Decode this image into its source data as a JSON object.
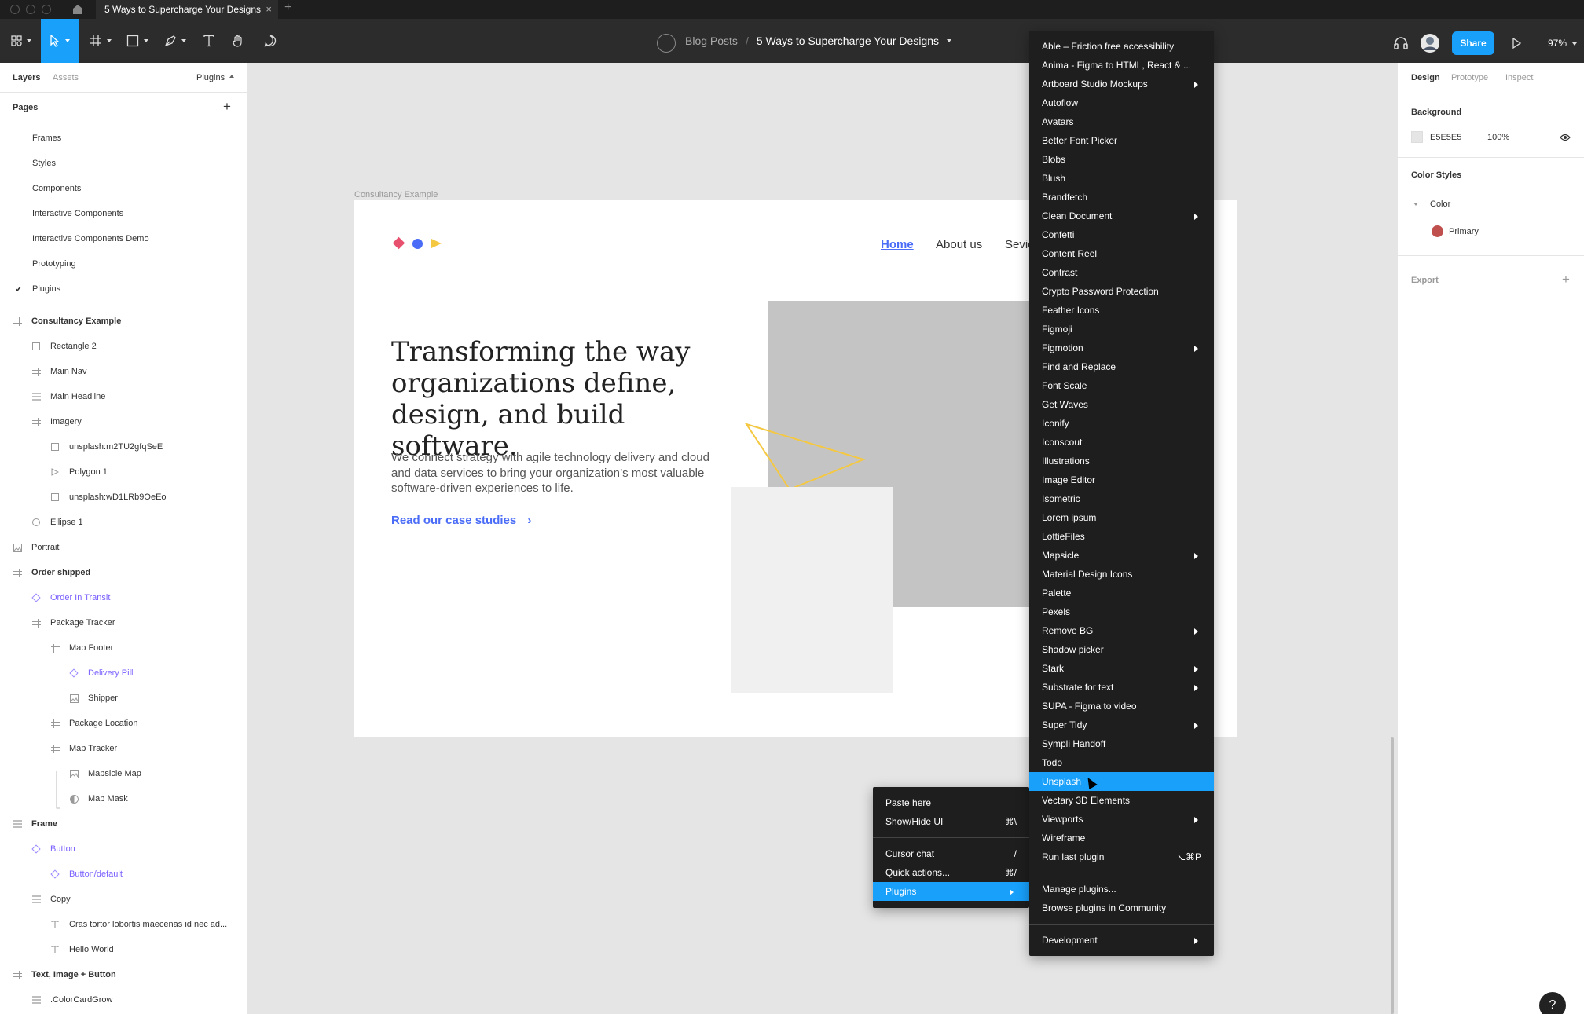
{
  "window": {
    "tab_title": "5 Ways to Supercharge Your Designs",
    "tab_close": "×",
    "new_tab": "+"
  },
  "toolbar": {
    "project": "Blog Posts",
    "separator": "/",
    "file": "5 Ways to Supercharge Your Designs",
    "share": "Share",
    "zoom": "97%"
  },
  "left_panel": {
    "tabs": {
      "layers": "Layers",
      "assets": "Assets",
      "plugins": "Plugins"
    },
    "pages_heading": "Pages",
    "add_page": "+",
    "pages": [
      "Frames",
      "Styles",
      "Components",
      "Interactive Components",
      "Interactive Components Demo",
      "Prototyping",
      "Plugins"
    ],
    "current_page_check": "✔",
    "layers": [
      {
        "name": "Consultancy Example",
        "icon": "frame-icon",
        "bold": true
      },
      {
        "name": "Rectangle 2",
        "icon": "rectangle-icon"
      },
      {
        "name": "Main Nav",
        "icon": "frame-icon"
      },
      {
        "name": "Main Headline",
        "icon": "autolayout-icon"
      },
      {
        "name": "Imagery",
        "icon": "frame-icon"
      },
      {
        "name": "unsplash:m2TU2gfqSeE",
        "icon": "rectangle-icon"
      },
      {
        "name": "Polygon 1",
        "icon": "polygon-icon"
      },
      {
        "name": "unsplash:wD1LRb9OeEo",
        "icon": "rectangle-icon"
      },
      {
        "name": "Ellipse 1",
        "icon": "ellipse-icon"
      },
      {
        "name": "Portrait",
        "icon": "image-icon"
      },
      {
        "name": "Order shipped",
        "icon": "frame-icon",
        "bold": true
      },
      {
        "name": "Order In Transit",
        "icon": "component-instance-icon",
        "purple": true
      },
      {
        "name": "Package Tracker",
        "icon": "frame-icon"
      },
      {
        "name": "Map Footer",
        "icon": "frame-icon"
      },
      {
        "name": "Delivery Pill",
        "icon": "component-instance-icon",
        "purple": true
      },
      {
        "name": "Shipper",
        "icon": "image-icon"
      },
      {
        "name": "Package Location",
        "icon": "frame-icon"
      },
      {
        "name": "Map Tracker",
        "icon": "frame-icon"
      },
      {
        "name": "Mapsicle Map",
        "icon": "image-icon"
      },
      {
        "name": "Map Mask",
        "icon": "mask-icon"
      },
      {
        "name": "Frame",
        "icon": "autolayout-icon",
        "bold": true
      },
      {
        "name": "Button",
        "icon": "component-instance-icon",
        "purple": true
      },
      {
        "name": "Button/default",
        "icon": "component-instance-icon",
        "purple": true
      },
      {
        "name": "Copy",
        "icon": "autolayout-icon"
      },
      {
        "name": "Cras tortor lobortis maecenas id nec ad...",
        "icon": "text-icon"
      },
      {
        "name": "Hello World",
        "icon": "text-icon"
      },
      {
        "name": "Text, Image + Button",
        "icon": "frame-icon",
        "bold": true
      },
      {
        "name": ".ColorCardGrow",
        "icon": "autolayout-icon"
      }
    ]
  },
  "canvas": {
    "frame_label": "Consultancy Example",
    "nav": {
      "home": "Home",
      "about": "About us",
      "services": "Sevic"
    },
    "headline": "Transforming the way organizations define, design, and build software.",
    "subtext": "We connect strategy with agile technology delivery and cloud and data services to bring your organization’s most valuable software-driven experiences to life.",
    "cta": "Read our case studies",
    "cta_arrow": "›"
  },
  "right_panel": {
    "tabs": {
      "design": "Design",
      "prototype": "Prototype",
      "inspect": "Inspect"
    },
    "background_heading": "Background",
    "background_hex": "E5E5E5",
    "background_opacity": "100%",
    "color_styles_heading": "Color Styles",
    "color_group": "Color",
    "color_primary": "Primary",
    "primary_swatch": "#c0504d",
    "export_heading": "Export",
    "export_add": "+"
  },
  "context_menu": {
    "items": [
      {
        "label": "Paste here",
        "shortcut": ""
      },
      {
        "label": "Show/Hide UI",
        "shortcut": "⌘\\"
      },
      {
        "label": "Cursor chat",
        "shortcut": "/"
      },
      {
        "label": "Quick actions...",
        "shortcut": "⌘/"
      },
      {
        "label": "Plugins",
        "shortcut": "",
        "highlighted": true,
        "submenu": true
      }
    ]
  },
  "plugins_menu": {
    "items": [
      {
        "label": "Able – Friction free accessibility"
      },
      {
        "label": "Anima - Figma to HTML, React & ..."
      },
      {
        "label": "Artboard Studio Mockups",
        "submenu": true
      },
      {
        "label": "Autoflow"
      },
      {
        "label": "Avatars"
      },
      {
        "label": "Better Font Picker"
      },
      {
        "label": "Blobs"
      },
      {
        "label": "Blush"
      },
      {
        "label": "Brandfetch"
      },
      {
        "label": "Clean Document",
        "submenu": true
      },
      {
        "label": "Confetti"
      },
      {
        "label": "Content Reel"
      },
      {
        "label": "Contrast"
      },
      {
        "label": "Crypto Password Protection"
      },
      {
        "label": "Feather Icons"
      },
      {
        "label": "Figmoji"
      },
      {
        "label": "Figmotion",
        "submenu": true
      },
      {
        "label": "Find and Replace"
      },
      {
        "label": "Font Scale"
      },
      {
        "label": "Get Waves"
      },
      {
        "label": "Iconify"
      },
      {
        "label": "Iconscout"
      },
      {
        "label": "Illustrations"
      },
      {
        "label": "Image Editor"
      },
      {
        "label": "Isometric"
      },
      {
        "label": "Lorem ipsum"
      },
      {
        "label": "LottieFiles"
      },
      {
        "label": "Mapsicle",
        "submenu": true
      },
      {
        "label": "Material Design Icons"
      },
      {
        "label": "Palette"
      },
      {
        "label": "Pexels"
      },
      {
        "label": "Remove BG",
        "submenu": true
      },
      {
        "label": "Shadow picker"
      },
      {
        "label": "Stark",
        "submenu": true
      },
      {
        "label": "Substrate for text",
        "submenu": true
      },
      {
        "label": "SUPA - Figma to video"
      },
      {
        "label": "Super Tidy",
        "submenu": true
      },
      {
        "label": "Sympli Handoff"
      },
      {
        "label": "Todo"
      },
      {
        "label": "Unsplash",
        "highlighted": true
      },
      {
        "label": "Vectary 3D Elements"
      },
      {
        "label": "Viewports",
        "submenu": true
      },
      {
        "label": "Wireframe"
      },
      {
        "label": "Run last plugin",
        "shortcut": "⌥⌘P"
      }
    ],
    "manage": "Manage plugins...",
    "browse": "Browse plugins in Community",
    "development": "Development"
  },
  "help": "?"
}
